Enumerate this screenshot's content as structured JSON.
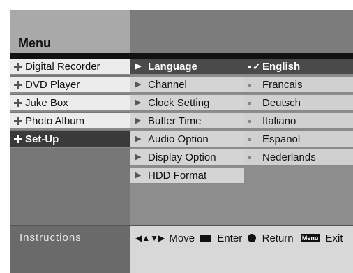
{
  "menu": {
    "title": "Menu"
  },
  "left_menu": [
    {
      "label": "Digital Recorder"
    },
    {
      "label": "DVD Player"
    },
    {
      "label": "Juke Box"
    },
    {
      "label": "Photo Album"
    },
    {
      "label": "Set-Up",
      "selected": true
    }
  ],
  "setup_menu": [
    {
      "label": "Language",
      "selected": true
    },
    {
      "label": "Channel"
    },
    {
      "label": "Clock Setting"
    },
    {
      "label": "Buffer Time"
    },
    {
      "label": "Audio Option"
    },
    {
      "label": "Display Option"
    },
    {
      "label": "HDD Format"
    }
  ],
  "language_options": [
    {
      "label": "English",
      "selected": true,
      "check": "✓"
    },
    {
      "label": "Francais"
    },
    {
      "label": "Deutsch"
    },
    {
      "label": "Italiano"
    },
    {
      "label": "Espanol"
    },
    {
      "label": "Nederlands"
    }
  ],
  "instructions": {
    "label": "Instructions",
    "nav_glyph": "◀▲▼▶",
    "move": "Move",
    "enter": "Enter",
    "return": "Return",
    "menu_key": "Menu",
    "exit": "Exit"
  },
  "colors": {
    "panel_dark": "#6a6a6a",
    "panel_mid": "#8d8d8d",
    "item_light": "#ececec",
    "item_selected": "#3a3a3a"
  }
}
